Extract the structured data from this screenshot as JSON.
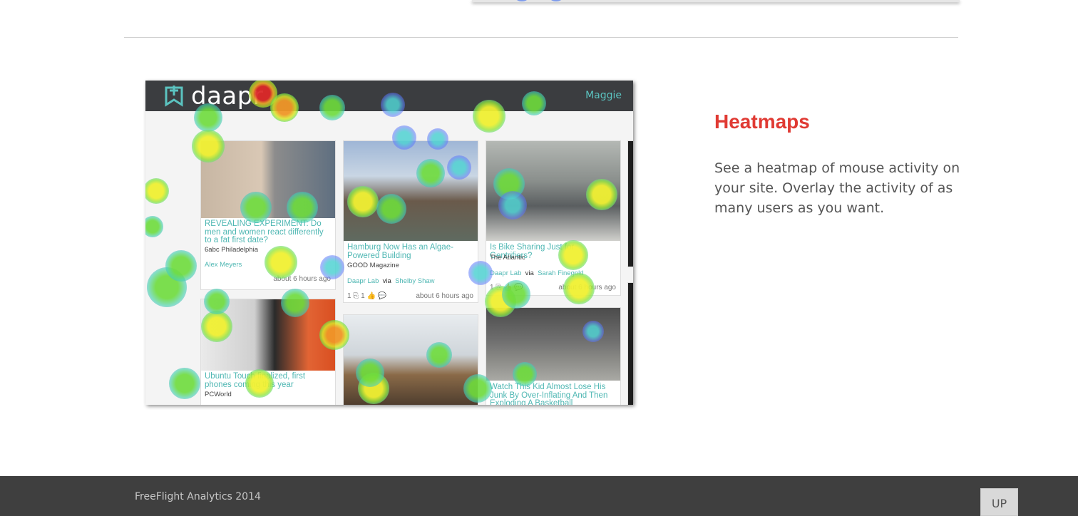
{
  "feature": {
    "title": "Heatmaps",
    "description": "See a heatmap of mouse activity on your site. Overlay the activity of as many users as you want."
  },
  "preview": {
    "app_name": "daapr",
    "user_name": "Maggie",
    "cards": [
      {
        "title": "REVEALING EXPERIMENT: Do men and women react differently to a fat first date?",
        "source": "6abc Philadelphia",
        "sharer": "Alex Meyers",
        "via": "",
        "via_user": "",
        "counts": "",
        "time": "about 6 hours ago"
      },
      {
        "title": "Hamburg Now Has an Algae-Powered Building",
        "source": "GOOD Magazine",
        "sharer": "Daapr Lab",
        "via": "via",
        "via_user": "Shelby Shaw",
        "counts": "1 ⎘ 1 👍 💬",
        "time": "about 6 hours ago"
      },
      {
        "title": "Is Bike Sharing Just for Gentrifiers?",
        "source": "The Atlantic",
        "sharer": "Daapr Lab",
        "via": "via",
        "via_user": "Sarah Finegold",
        "counts": "1 ⎘ 👍 💬",
        "time": "about 6 hours ago"
      },
      {
        "title": "Ubuntu Touch finalized, first phones coming this year",
        "source": "PCWorld",
        "sharer": "",
        "via": "",
        "via_user": "",
        "counts": "",
        "time": ""
      },
      {
        "title": "",
        "source": "",
        "sharer": "",
        "via": "",
        "via_user": "",
        "counts": "",
        "time": ""
      },
      {
        "title": "Watch This Kid Almost Lose His Junk By Over-Inflating And Then Exploding A Basketball",
        "source": "",
        "sharer": "",
        "via": "",
        "via_user": "",
        "counts": "",
        "time": ""
      }
    ]
  },
  "footer": {
    "copyright": "FreeFlight Analytics 2014",
    "up_label": "UP"
  },
  "colors": {
    "accent_red": "#e03a33",
    "teal_link": "#4fb7b3",
    "footer_bg": "#3f3f3f"
  }
}
